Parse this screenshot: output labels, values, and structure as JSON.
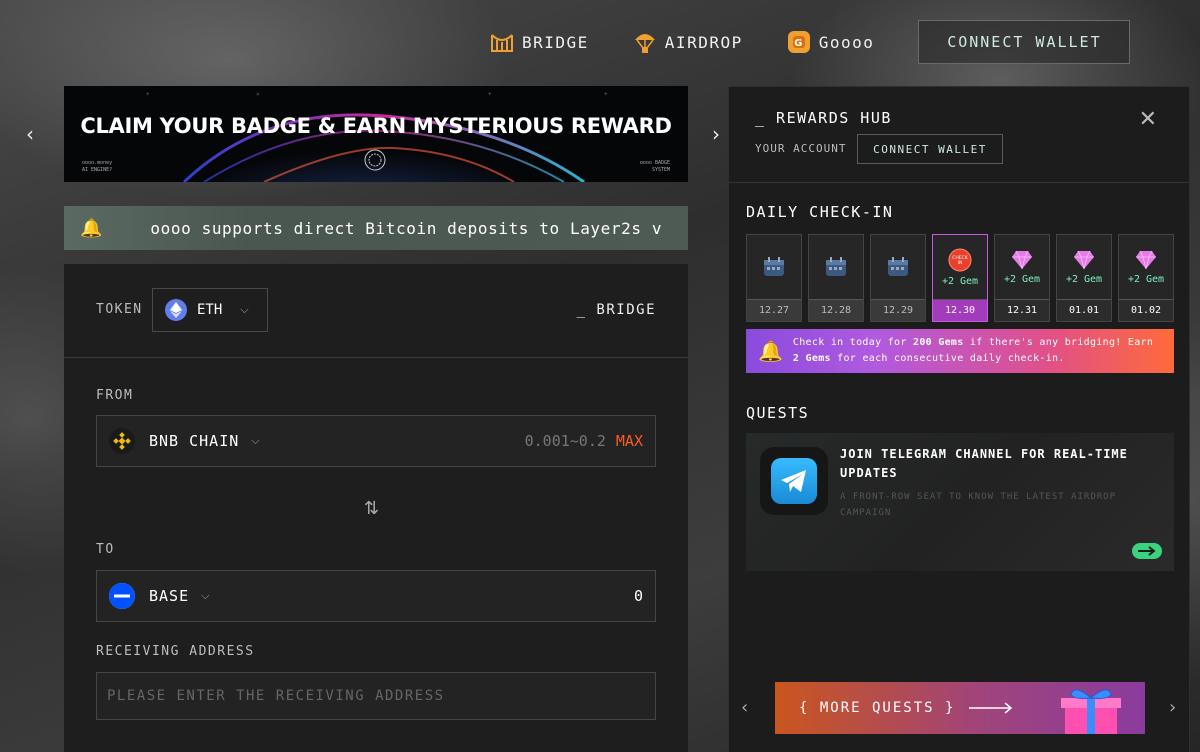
{
  "nav": {
    "items": [
      {
        "label": "BRIDGE",
        "icon": "bridge-icon"
      },
      {
        "label": "AIRDROP",
        "icon": "airdrop-icon"
      },
      {
        "label": "Goooo",
        "icon": "goooo-coin-icon"
      }
    ],
    "connect_label": "CONNECT WALLET"
  },
  "banner": {
    "title": "CLAIM YOUR BADGE & EARN MYSTERIOUS REWARD",
    "small_left_1": "oooo.money",
    "small_left_2": "AI ENGINE?",
    "small_right_1": "oooo BADGE",
    "small_right_2": "SYSTEM",
    "prev_icon": "chevron-left-icon",
    "next_icon": "chevron-right-icon"
  },
  "ticker": {
    "text": "oooo supports direct Bitcoin deposits to Layer2s v"
  },
  "bridge": {
    "token_label": "TOKEN",
    "token_value": "ETH",
    "title": "_ BRIDGE",
    "from_label": "FROM",
    "from_chain": "BNB CHAIN",
    "from_range": "0.001~0.2",
    "max_label": "MAX",
    "to_label": "TO",
    "to_chain": "BASE",
    "to_amount": "0",
    "receiving_label": "RECEIVING ADDRESS",
    "receiving_placeholder": "PLEASE ENTER THE RECEIVING ADDRESS"
  },
  "rewards": {
    "title": "_ REWARDS HUB",
    "account_label": "YOUR ACCOUNT",
    "connect_label": "CONNECT WALLET",
    "checkin_title": "DAILY CHECK-IN",
    "days": [
      {
        "date": "12.27",
        "state": "past",
        "reward": ""
      },
      {
        "date": "12.28",
        "state": "past",
        "reward": ""
      },
      {
        "date": "12.29",
        "state": "past",
        "reward": ""
      },
      {
        "date": "12.30",
        "state": "today",
        "reward": "+2 Gem",
        "badge": "CHECK IN"
      },
      {
        "date": "12.31",
        "state": "future",
        "reward": "+2 Gem"
      },
      {
        "date": "01.01",
        "state": "future",
        "reward": "+2 Gem"
      },
      {
        "date": "01.02",
        "state": "future",
        "reward": "+2 Gem"
      }
    ],
    "checkin_msg_1": "Check in today for ",
    "checkin_msg_bold_1": "200 Gems",
    "checkin_msg_2": " if there's any bridging! Earn",
    "checkin_msg_bold_2": "2 Gems",
    "checkin_msg_3": " for each consecutive daily check-in.",
    "quests_title": "QUESTS",
    "quest": {
      "title": "JOIN TELEGRAM CHANNEL FOR REAL-TIME UPDATES",
      "subtitle": "A FRONT-ROW SEAT TO KNOW THE LATEST AIRDROP CAMPAIGN"
    },
    "more_quests_label": "{ MORE QUESTS }"
  },
  "colors": {
    "accent_orange": "#ff5a1f",
    "gem_green": "#7ef0c0",
    "today_purple": "#a33bbd",
    "go_green": "#3ad27f"
  }
}
